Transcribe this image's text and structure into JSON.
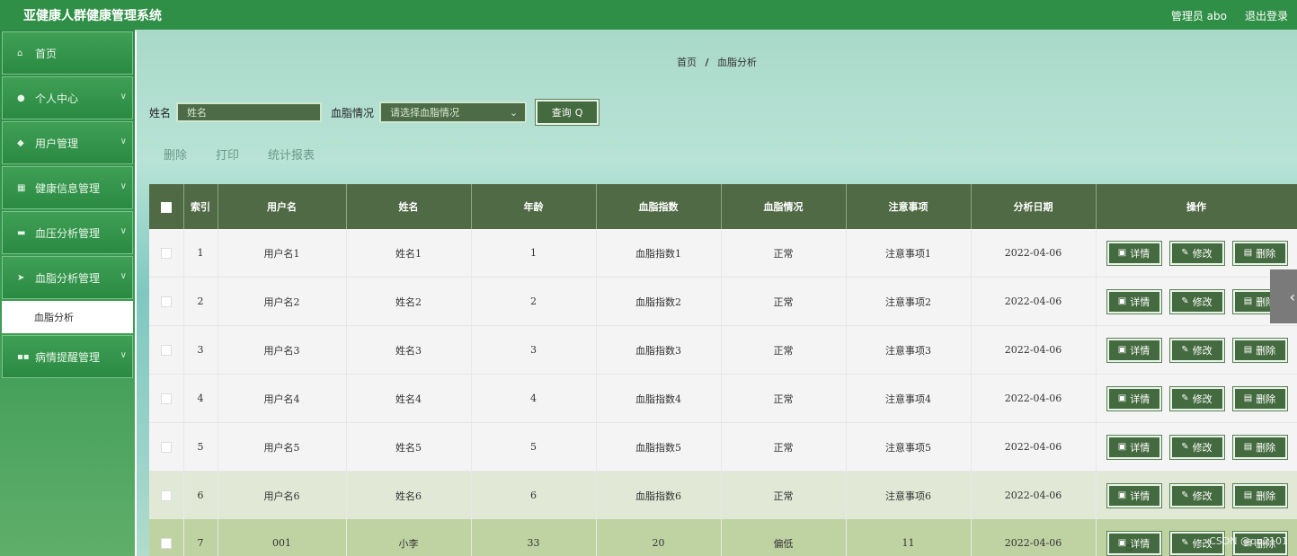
{
  "header": {
    "title": "亚健康人群健康管理系统",
    "user_info": "管理员 abo",
    "logout": "退出登录"
  },
  "sidebar": {
    "items": [
      {
        "icon": "home-icon",
        "label": "首页",
        "has_children": false
      },
      {
        "icon": "user-icon",
        "label": "个人中心",
        "has_children": true
      },
      {
        "icon": "users-icon",
        "label": "用户管理",
        "has_children": true
      },
      {
        "icon": "grid-icon",
        "label": "健康信息管理",
        "has_children": true
      },
      {
        "icon": "chart-icon",
        "label": "血压分析管理",
        "has_children": true
      },
      {
        "icon": "send-icon",
        "label": "血脂分析管理",
        "has_children": true
      },
      {
        "icon": "apps-icon",
        "label": "病情提醒管理",
        "has_children": true
      }
    ],
    "active_sub": "血脂分析"
  },
  "breadcrumb": {
    "home": "首页",
    "separator": "/",
    "current": "血脂分析"
  },
  "search": {
    "name_label": "姓名",
    "name_placeholder": "姓名",
    "status_label": "血脂情况",
    "status_placeholder": "请选择血脂情况",
    "query_button": "查询"
  },
  "actions": {
    "delete": "删除",
    "print": "打印",
    "report": "统计报表"
  },
  "table": {
    "headers": [
      "索引",
      "用户名",
      "姓名",
      "年龄",
      "血脂指数",
      "血脂情况",
      "注意事项",
      "分析日期",
      "操作"
    ],
    "rows": [
      {
        "index": "1",
        "username": "用户名1",
        "name": "姓名1",
        "age": "1",
        "index_value": "血脂指数1",
        "status": "正常",
        "note": "注意事项1",
        "date": "2022-04-06"
      },
      {
        "index": "2",
        "username": "用户名2",
        "name": "姓名2",
        "age": "2",
        "index_value": "血脂指数2",
        "status": "正常",
        "note": "注意事项2",
        "date": "2022-04-06"
      },
      {
        "index": "3",
        "username": "用户名3",
        "name": "姓名3",
        "age": "3",
        "index_value": "血脂指数3",
        "status": "正常",
        "note": "注意事项3",
        "date": "2022-04-06"
      },
      {
        "index": "4",
        "username": "用户名4",
        "name": "姓名4",
        "age": "4",
        "index_value": "血脂指数4",
        "status": "正常",
        "note": "注意事项4",
        "date": "2022-04-06"
      },
      {
        "index": "5",
        "username": "用户名5",
        "name": "姓名5",
        "age": "5",
        "index_value": "血脂指数5",
        "status": "正常",
        "note": "注意事项5",
        "date": "2022-04-06"
      },
      {
        "index": "6",
        "username": "用户名6",
        "name": "姓名6",
        "age": "6",
        "index_value": "血脂指数6",
        "status": "正常",
        "note": "注意事项6",
        "date": "2022-04-06"
      },
      {
        "index": "7",
        "username": "001",
        "name": "小李",
        "age": "33",
        "index_value": "20",
        "status": "偏低",
        "note": "11",
        "date": "2022-04-06"
      }
    ],
    "row_buttons": {
      "detail": "详情",
      "edit": "修改",
      "delete": "删除"
    }
  },
  "watermark": "CSDN @qq2101",
  "colors": {
    "primary": "#2f8f46",
    "button": "#446a3f",
    "table_header": "#4f6a45"
  }
}
